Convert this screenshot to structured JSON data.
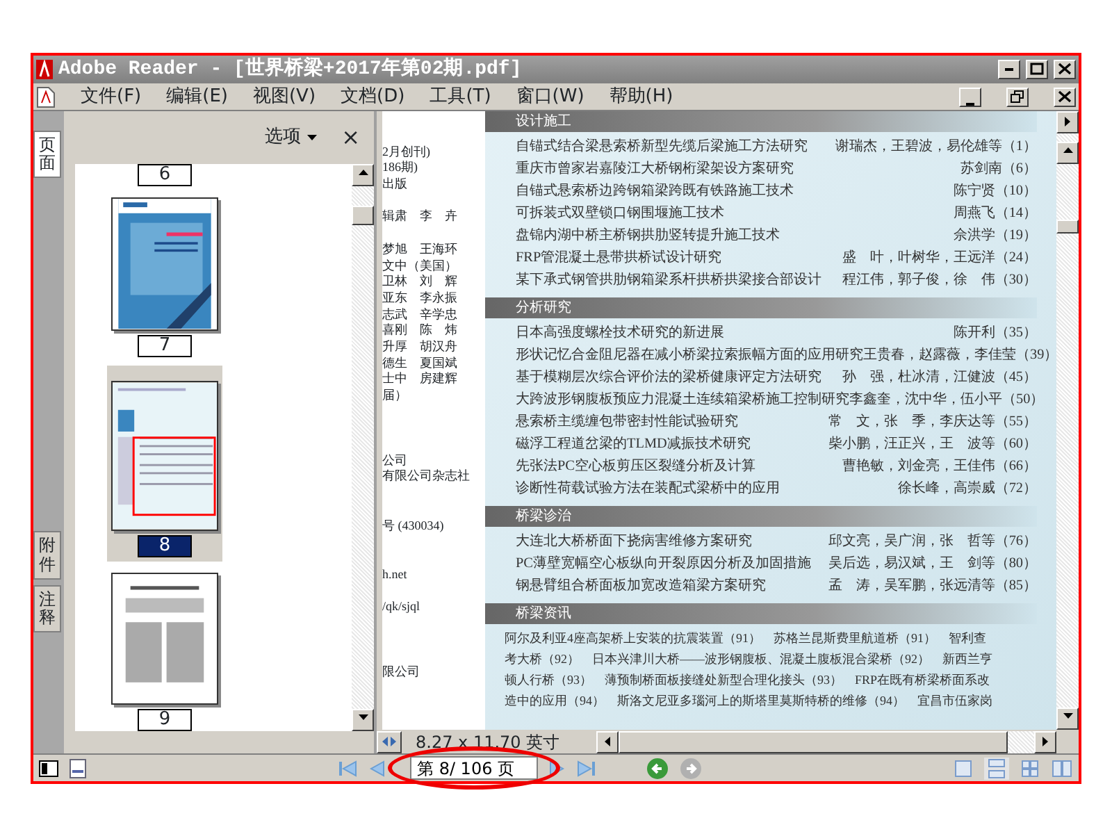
{
  "window": {
    "title": "Adobe Reader - [世界桥梁+2017年第02期.pdf]"
  },
  "menu": [
    "文件(F)",
    "编辑(E)",
    "视图(V)",
    "文档(D)",
    "工具(T)",
    "窗口(W)",
    "帮助(H)"
  ],
  "side_tabs": [
    {
      "label": "页面",
      "selected": true
    },
    {
      "label": "附件",
      "selected": false
    },
    {
      "label": "注释",
      "selected": false
    }
  ],
  "thumbnail_panel": {
    "options": "选项",
    "close": "×",
    "thumbnails": [
      {
        "label": "6",
        "kind": "cut",
        "selected": false
      },
      {
        "label": "7",
        "kind": "cover",
        "selected": false
      },
      {
        "label": "8",
        "kind": "toc",
        "selected": true
      },
      {
        "label": "9",
        "kind": "text",
        "selected": false
      }
    ]
  },
  "document": {
    "left_column": [
      [
        "2月创刊)",
        "186期)",
        "出版"
      ],
      [
        "辑肃　李　卉"
      ],
      [
        "梦旭　王海环",
        "文中（美国）",
        "卫林　刘　辉",
        "亚东　李永振",
        "志武　辛学忠",
        "喜刚　陈　炜",
        "升厚　胡汉舟",
        "德生　夏国斌",
        "士中　房建辉",
        "届）"
      ],
      [
        "公司",
        "有限公司杂志社"
      ],
      [
        "号 (430034)"
      ],
      [
        "h.net"
      ],
      [
        "/qk/sjql"
      ],
      [
        "限公司"
      ]
    ],
    "sections": [
      {
        "heading": "设计施工",
        "kind": "list",
        "items": [
          {
            "title": "自锚式结合梁悬索桥新型先缆后梁施工方法研究",
            "authors": "谢瑞杰，王碧波，易伦雄等",
            "page": "（1）"
          },
          {
            "title": "重庆市曾家岩嘉陵江大桥钢桁梁架设方案研究",
            "authors": "苏剑南",
            "page": "（6）"
          },
          {
            "title": "自锚式悬索桥边跨钢箱梁跨既有铁路施工技术",
            "authors": "陈宁贤",
            "page": "（10）"
          },
          {
            "title": "可拆装式双壁锁口钢围堰施工技术",
            "authors": "周燕飞",
            "page": "（14）"
          },
          {
            "title": "盘锦内湖中桥主桥钢拱肋竖转提升施工技术",
            "authors": "佘洪学",
            "page": "（19）"
          },
          {
            "title": "FRP管混凝土悬带拱桥试设计研究",
            "authors": "盛　叶，叶树华，王远洋",
            "page": "（24）"
          },
          {
            "title": "某下承式钢管拱肋钢箱梁系杆拱桥拱梁接合部设计",
            "authors": "程江伟，郭子俊，徐　伟",
            "page": "（30）"
          }
        ]
      },
      {
        "heading": "分析研究",
        "kind": "list",
        "items": [
          {
            "title": "日本高强度螺栓技术研究的新进展",
            "authors": "陈开利",
            "page": "（35）"
          },
          {
            "title": "形状记忆合金阻尼器在减小桥梁拉索振幅方面的应用研究",
            "authors": "王贵春，赵露薇，李佳莹",
            "page": "（39）"
          },
          {
            "title": "基于模糊层次综合评价法的梁桥健康评定方法研究",
            "authors": "孙　强，杜冰清，江健波",
            "page": "（45）"
          },
          {
            "title": "大跨波形钢腹板预应力混凝土连续箱梁桥施工控制研究",
            "authors": "李鑫奎，沈中华，伍小平",
            "page": "（50）"
          },
          {
            "title": "悬索桥主缆缠包带密封性能试验研究",
            "authors": "常　文，张　季，李庆达等",
            "page": "（55）"
          },
          {
            "title": "磁浮工程道岔梁的TLMD减振技术研究",
            "authors": "柴小鹏，汪正兴，王　波等",
            "page": "（60）"
          },
          {
            "title": "先张法PC空心板剪压区裂缝分析及计算",
            "authors": "曹艳敏，刘金亮，王佳伟",
            "page": "（66）"
          },
          {
            "title": "诊断性荷载试验方法在装配式梁桥中的应用",
            "authors": "徐长峰，高崇威",
            "page": "（72）"
          }
        ]
      },
      {
        "heading": "桥梁诊治",
        "kind": "list",
        "items": [
          {
            "title": "大连北大桥桥面下挠病害维修方案研究",
            "authors": "邱文亮，吴广润，张　哲等",
            "page": "（76）"
          },
          {
            "title": "PC薄壁宽幅空心板纵向开裂原因分析及加固措施",
            "authors": "吴后选，易汉斌，王　剑等",
            "page": "（80）"
          },
          {
            "title": "钢悬臂组合桥面板加宽改造箱梁方案研究",
            "authors": "孟　涛，吴军鹏，张远清等",
            "page": "（85）"
          }
        ]
      },
      {
        "heading": "桥梁资讯",
        "kind": "text",
        "lines": [
          "阿尔及利亚4座高架桥上安装的抗震装置（91）　苏格兰昆斯费里航道桥（91）　智利查",
          "考大桥（92）　日本兴津川大桥——波形钢腹板、混凝土腹板混合梁桥（92）　新西兰亨",
          "顿人行桥（93）　薄预制桥面板接缝处新型合理化接头（93）　FRP在既有桥梁桥面系改",
          "造中的应用（94）　斯洛文尼亚多瑙河上的斯塔里莫斯特桥的维修（94）　宜昌市伍家岗"
        ]
      }
    ],
    "page_size": "8.27 x 11.70 英寸"
  },
  "status_bar": {
    "page_field": "第 8/ 106 页",
    "forward_disabled": true
  }
}
